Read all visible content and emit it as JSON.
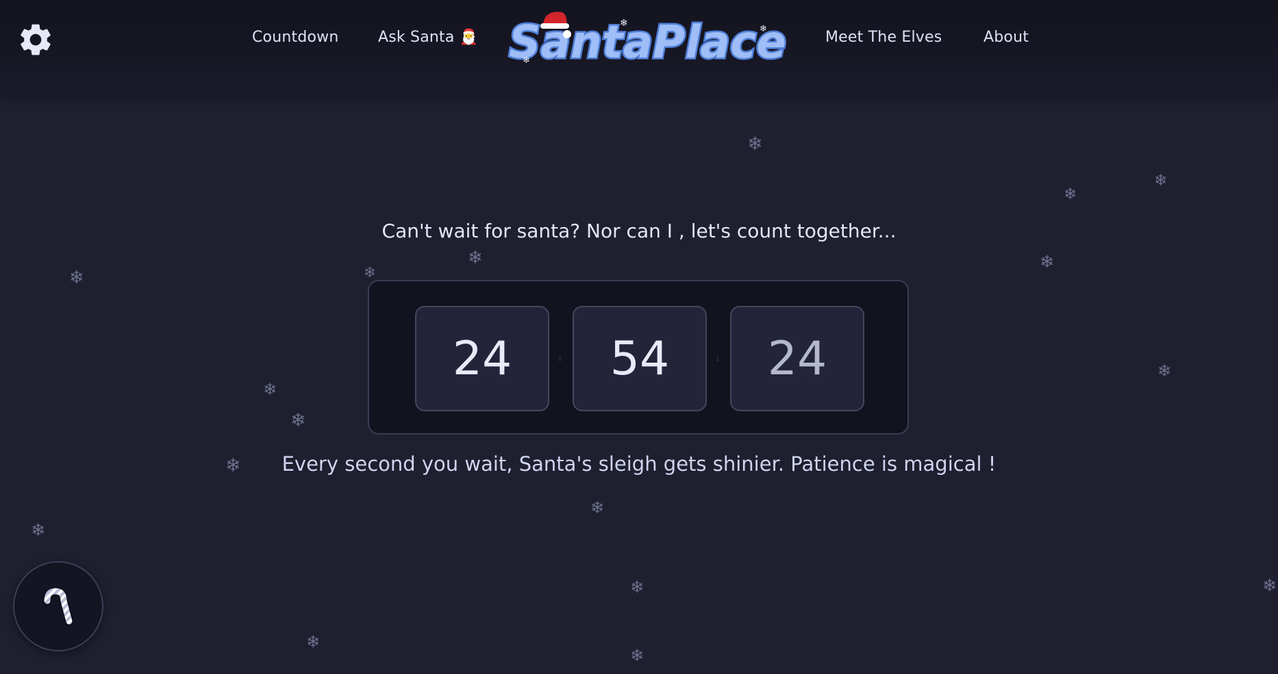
{
  "header": {
    "settings_icon": "gear-icon",
    "nav": {
      "countdown": "Countdown",
      "ask_santa": "Ask Santa 🎅",
      "meet_elves": "Meet The Elves",
      "about": "About"
    },
    "logo_text": "SantaPlace"
  },
  "main": {
    "subtitle": "Can't wait for santa? Nor can I , let's count together...",
    "timer": {
      "hours": "24",
      "minutes": "54",
      "seconds": "24",
      "separator": ":"
    },
    "tagline": "Every second you wait, Santa's sleigh gets shinier. Patience is magical !"
  },
  "floating_button": {
    "icon": "candy-cane-icon"
  },
  "decor": {
    "snowflake_glyph": "❄"
  },
  "colors": {
    "background": "#1f1f30",
    "header": "#14141f",
    "logo_fill": "#9fbdf6",
    "logo_stroke": "#4f7fd9",
    "hat_red": "#d3262b"
  }
}
